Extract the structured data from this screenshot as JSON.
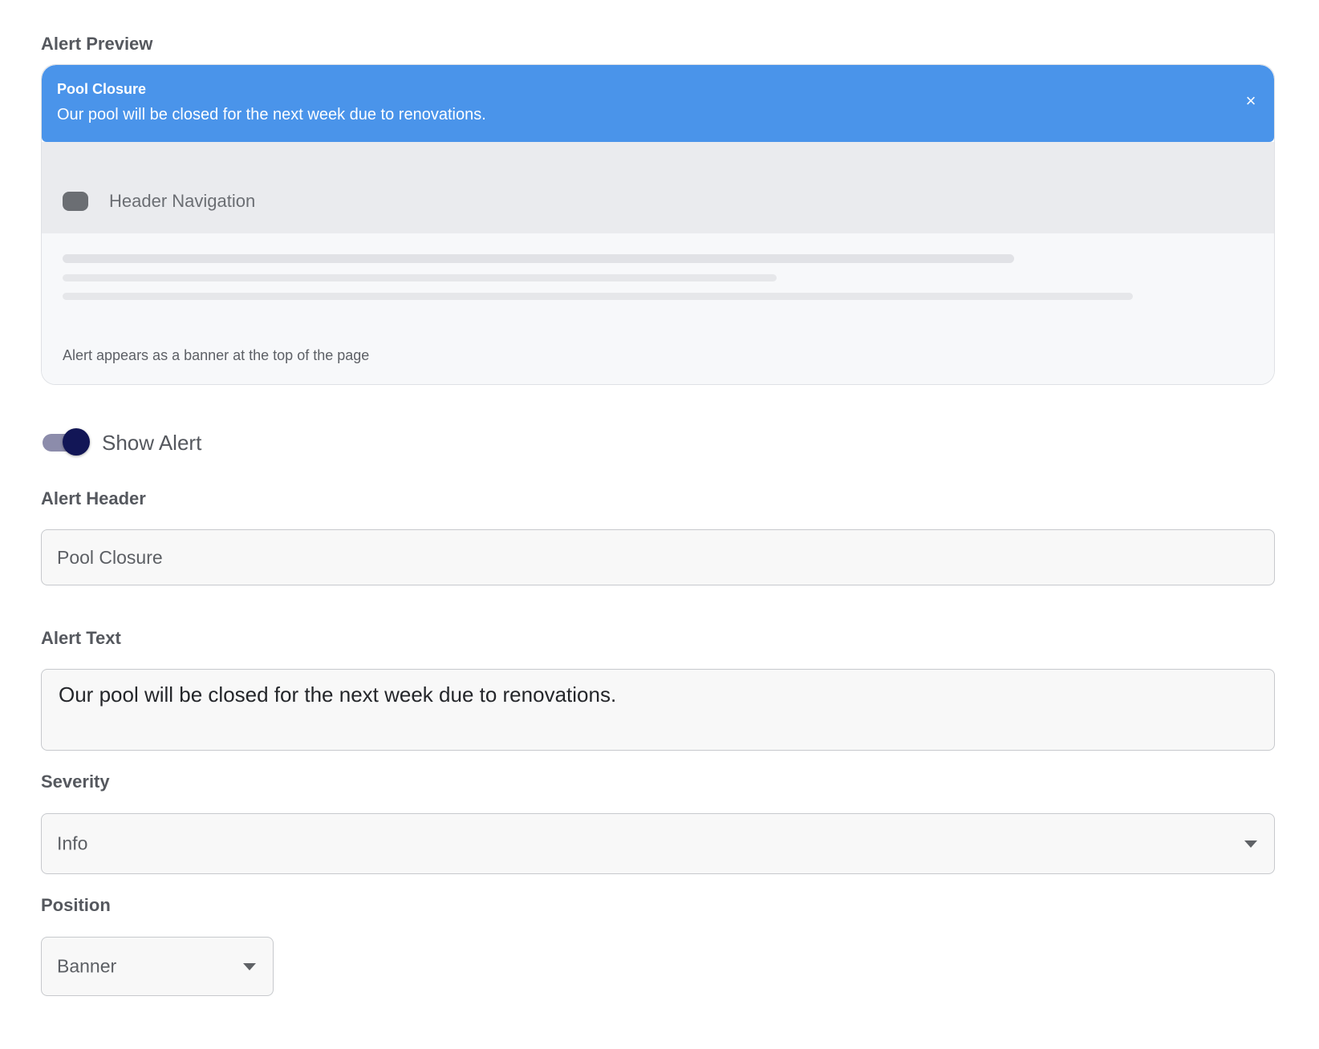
{
  "preview": {
    "heading": "Alert Preview",
    "banner": {
      "title": "Pool Closure",
      "message": "Our pool will be closed for the next week due to renovations.",
      "close_icon": "×"
    },
    "mock_nav_label": "Header Navigation",
    "caption": "Alert appears as a banner at the top of the page"
  },
  "toggle": {
    "label": "Show Alert",
    "checked": true
  },
  "form": {
    "header_label": "Alert Header",
    "header_value": "Pool Closure",
    "text_label": "Alert Text",
    "text_value": "Our pool will be closed for the next week due to renovations.",
    "severity_label": "Severity",
    "severity_value": "Info",
    "position_label": "Position",
    "position_value": "Banner"
  },
  "colors": {
    "banner_bg": "#4a94ea",
    "toggle_knob": "#121656",
    "toggle_track": "#8c8cab"
  }
}
